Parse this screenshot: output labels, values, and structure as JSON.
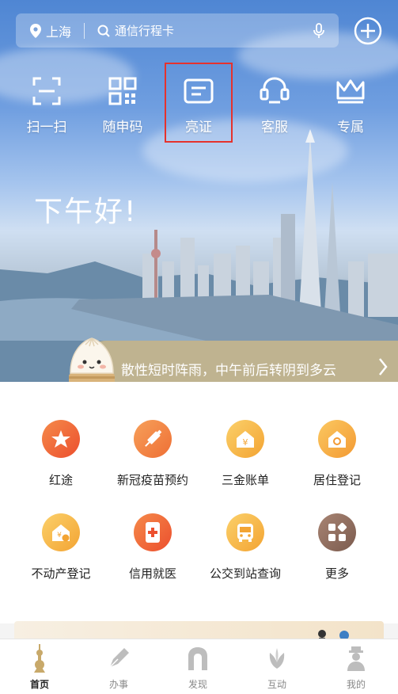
{
  "header": {
    "location": "上海",
    "search_placeholder": "通信行程卡"
  },
  "quick_actions": [
    {
      "label": "扫一扫",
      "icon": "scan-icon"
    },
    {
      "label": "随申码",
      "icon": "qr-code-icon"
    },
    {
      "label": "亮证",
      "icon": "id-card-icon"
    },
    {
      "label": "客服",
      "icon": "headset-icon"
    },
    {
      "label": "专属",
      "icon": "crown-icon"
    }
  ],
  "greeting": "下午好!",
  "weather": {
    "text": "散性短时阵雨，中午前后转阴到多云"
  },
  "services": [
    {
      "label": "红途",
      "icon": "star-icon",
      "color": "#f0672f"
    },
    {
      "label": "新冠疫苗预约",
      "icon": "syringe-icon",
      "color": "#f07a36"
    },
    {
      "label": "三金账单",
      "icon": "yuan-house-icon",
      "color": "#f5b43a"
    },
    {
      "label": "居住登记",
      "icon": "home-icon",
      "color": "#f5ac3a"
    },
    {
      "label": "不动产登记",
      "icon": "property-icon",
      "color": "#f5b43a"
    },
    {
      "label": "信用就医",
      "icon": "phone-medical-icon",
      "color": "#f06a3a"
    },
    {
      "label": "公交到站查询",
      "icon": "bus-icon",
      "color": "#f5b43a"
    },
    {
      "label": "更多",
      "icon": "more-grid-icon",
      "color": "#8a6a5c"
    }
  ],
  "tabs": [
    {
      "label": "首页",
      "icon": "pearl-tower-icon",
      "active": true
    },
    {
      "label": "办事",
      "icon": "pen-icon",
      "active": false
    },
    {
      "label": "发现",
      "icon": "arch-icon",
      "active": false
    },
    {
      "label": "互动",
      "icon": "magnolia-icon",
      "active": false
    },
    {
      "label": "我的",
      "icon": "person-icon",
      "active": false
    }
  ],
  "colors": {
    "highlight": "#e5322d",
    "active_tab": "#c8a96a"
  }
}
